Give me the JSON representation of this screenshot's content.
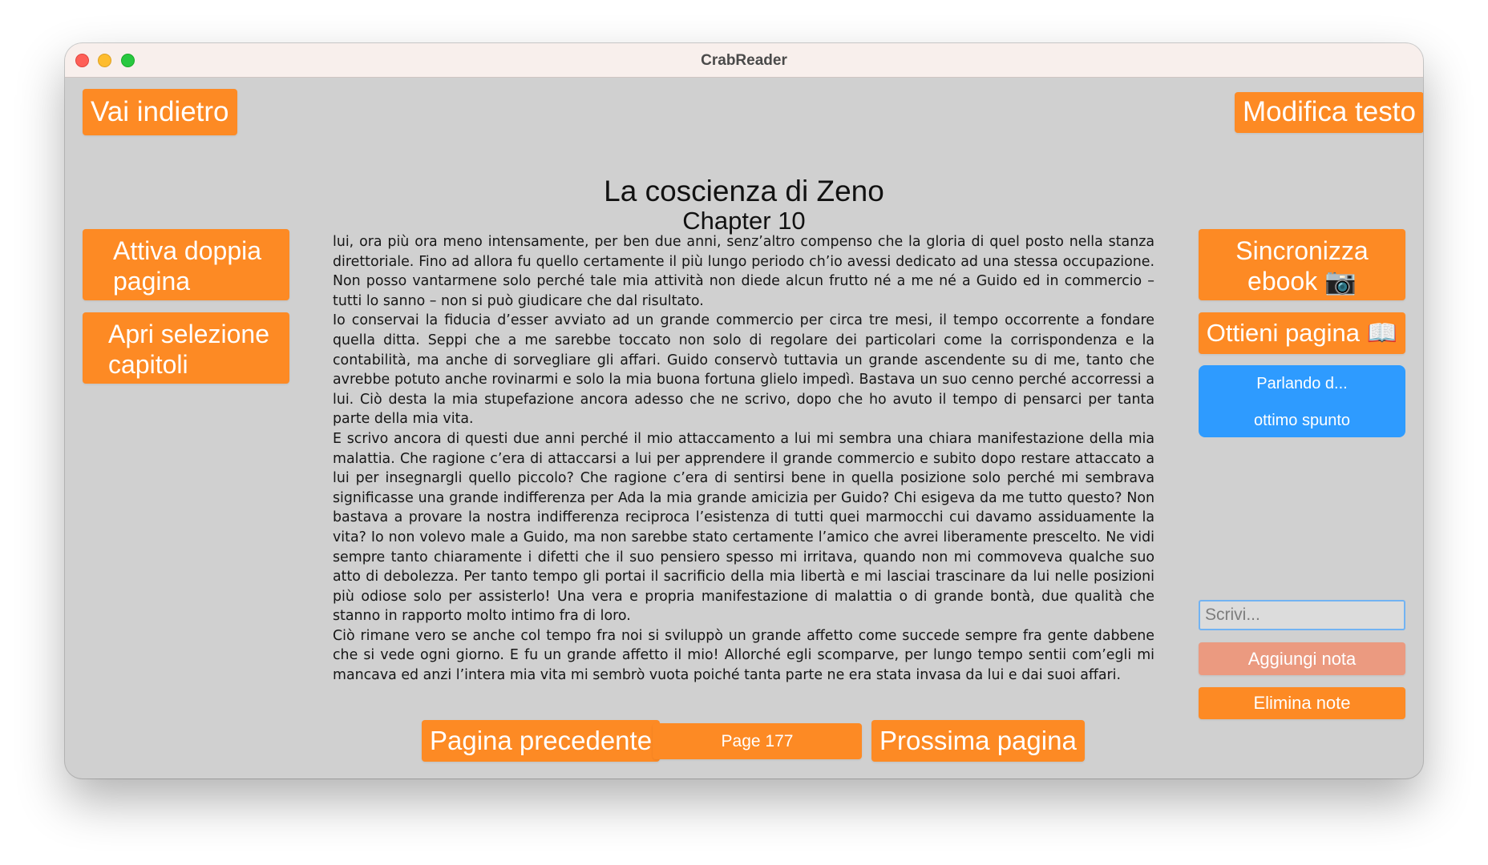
{
  "window": {
    "title": "CrabReader"
  },
  "header": {
    "back_label": "Vai indietro",
    "edit_label": "Modifica testo",
    "book_title": "La coscienza di Zeno",
    "chapter": "Chapter 10"
  },
  "left_panel": {
    "double_page_label_1": "Attiva doppia",
    "double_page_label_2": "pagina",
    "chapters_label_1": "Apri selezione",
    "chapters_label_2": "capitoli"
  },
  "right_panel": {
    "sync_label_1": "Sincronizza",
    "sync_label_2": "ebook 📷",
    "get_page_label": "Ottieni pagina 📖",
    "notes": [
      "Parlando d...",
      "ottimo spunto"
    ],
    "note_placeholder": "Scrivi...",
    "add_note_label": "Aggiungi nota",
    "delete_notes_label": "Elimina note"
  },
  "reader": {
    "paragraphs": [
      "lui, ora più ora meno intensamente, per ben due anni, senz’altro compenso che la gloria di quel posto nella stanza direttoriale. Fino ad allora fu quello certamente il più lungo periodo ch’io avessi dedicato ad una stessa occupazione. Non posso vantarmene solo perché tale mia attività non diede alcun frutto né a me né a Guido ed in commercio – tutti lo sanno – non si può giudicare che dal risultato.",
      "Io conservai la fiducia d’esser avviato ad un grande commercio per circa tre mesi, il tempo occorrente a fondare quella ditta. Seppi che a me sarebbe toccato non solo di regolare dei particolari come la corrispondenza e la contabilità, ma anche di sorvegliare gli affari. Guido conservò tuttavia un grande ascendente su di me, tanto che avrebbe potuto anche rovinarmi e solo la mia buona fortuna glielo impedì. Bastava un suo cenno perché accorressi a lui. Ciò desta la mia stupefazione ancora adesso che ne scrivo, dopo che ho avuto il tempo di pensarci per tanta parte della mia vita.",
      "E scrivo ancora di questi due anni perché il mio attaccamento a lui mi sembra una chiara manifestazione della mia malattia. Che ragione c’era di attaccarsi a lui per apprendere il grande commercio e subito dopo restare attaccato a lui per insegnargli quello piccolo? Che ragione c’era di sentirsi bene in quella posizione solo perché mi sembrava significasse una grande indifferenza per Ada la mia grande amicizia per Guido? Chi esigeva da me tutto questo? Non bastava a provare la nostra indifferenza reciproca l’esistenza di tutti quei marmocchi cui davamo assiduamente la vita? Io non volevo male a Guido, ma non sarebbe stato certamente l’amico che avrei liberamente prescelto. Ne vidi sempre tanto chiaramente i difetti che il suo pensiero spesso mi irritava, quando non mi commoveva qualche suo atto di debolezza. Per tanto tempo gli portai il sacrificio della mia libertà e mi lasciai trascinare da lui nelle posizioni più odiose solo per assisterlo! Una vera e propria manifestazione di malattia o di grande bontà, due qualità che stanno in rapporto molto intimo fra di loro.",
      "Ciò rimane vero se anche col tempo fra noi si sviluppò un grande affetto come succede sempre fra gente dabbene che si vede ogni giorno. E fu un grande affetto il mio! Allorché egli scomparve, per lungo tempo sentii com’egli mi mancava ed anzi l’intera mia vita mi sembrò vuota poiché tanta parte ne era stata invasa da lui e dai suoi affari."
    ]
  },
  "footer": {
    "prev_label": "Pagina precedente",
    "page_label": "Page 177",
    "next_label": "Prossima pagina"
  },
  "colors": {
    "accent": "#fd8a24",
    "note_panel": "#2e9bff",
    "add_note": "#eb9a80",
    "background": "#d0d0d0",
    "titlebar": "#f8efec"
  }
}
